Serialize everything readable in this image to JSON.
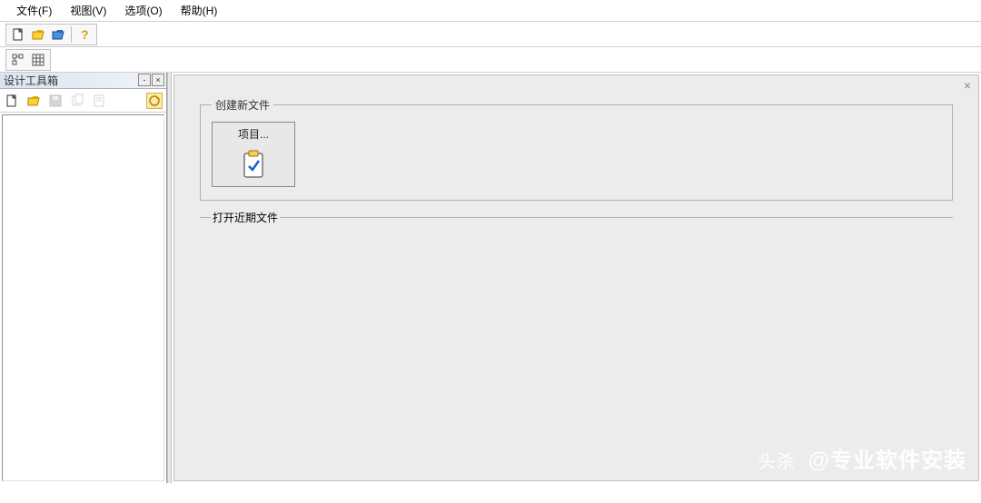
{
  "menubar": {
    "file": "文件(F)",
    "view": "视图(V)",
    "options": "选项(O)",
    "help": "帮助(H)"
  },
  "left_panel": {
    "title": "设计工具箱"
  },
  "main": {
    "create_group": "创建新文件",
    "project_btn": "项目...",
    "recent_group": "打开近期文件"
  },
  "watermark": {
    "prefix": "头杀",
    "text": "@专业软件安装"
  }
}
